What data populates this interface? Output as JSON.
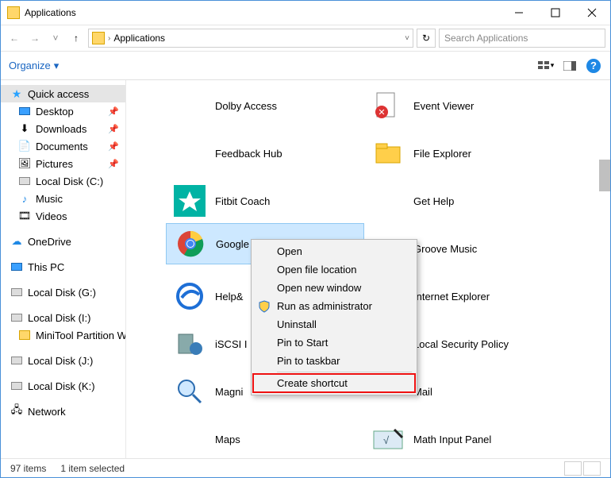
{
  "window": {
    "title": "Applications"
  },
  "titlebar_buttons": {
    "min": "–",
    "max": "□",
    "close": "✕"
  },
  "address": {
    "back": "←",
    "forward": "→",
    "recent": "˅",
    "up": "↑",
    "crumb": "Applications",
    "dropdown": "˅",
    "refresh": "↻"
  },
  "search": {
    "placeholder": "Search Applications",
    "icon": "🔍"
  },
  "cmdbar": {
    "organize": "Organize",
    "caret": "▾",
    "help": "?"
  },
  "sidebar": {
    "quick_access": "Quick access",
    "desktop": "Desktop",
    "downloads": "Downloads",
    "documents": "Documents",
    "pictures": "Pictures",
    "localc": "Local Disk (C:)",
    "music": "Music",
    "videos": "Videos",
    "onedrive": "OneDrive",
    "thispc": "This PC",
    "localg": "Local Disk (G:)",
    "locali": "Local Disk (I:)",
    "minitool": "MiniTool Partition W",
    "localj": "Local Disk (J:)",
    "localk": "Local Disk (K:)",
    "network": "Network"
  },
  "items": {
    "dolby": "Dolby Access",
    "eventviewer": "Event Viewer",
    "feedback": "Feedback Hub",
    "fileexplorer": "File Explorer",
    "fitbit": "Fitbit Coach",
    "gethelp": "Get Help",
    "chrome": "Google Chrome",
    "groove": "Groove Music",
    "help": "Help&",
    "ie": "Internet Explorer",
    "iscsi": "iSCSI I",
    "localsec": "Local Security Policy",
    "magni": "Magni",
    "mail": "Mail",
    "maps": "Maps",
    "mathinput": "Math Input Panel"
  },
  "context_menu": {
    "open": "Open",
    "openloc": "Open file location",
    "openwin": "Open new window",
    "runadmin": "Run as administrator",
    "uninstall": "Uninstall",
    "pinstart": "Pin to Start",
    "pintask": "Pin to taskbar",
    "create": "Create shortcut"
  },
  "status": {
    "count": "97 items",
    "selected": "1 item selected"
  }
}
